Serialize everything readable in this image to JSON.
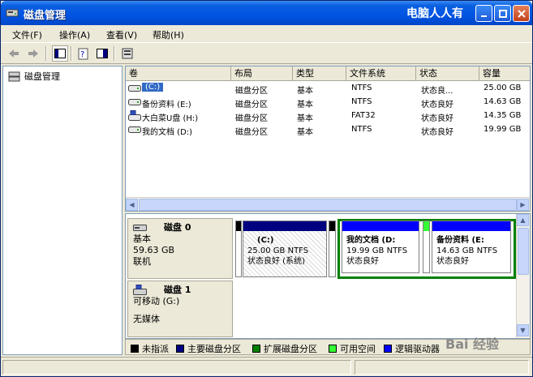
{
  "window": {
    "title": "磁盘管理",
    "watermark": "电脑人人有"
  },
  "menu": [
    {
      "label": "文件(F)"
    },
    {
      "label": "操作(A)"
    },
    {
      "label": "查看(V)"
    },
    {
      "label": "帮助(H)"
    }
  ],
  "tree": {
    "root_label": "磁盘管理"
  },
  "volume_table": {
    "columns": [
      "卷",
      "布局",
      "类型",
      "文件系统",
      "状态",
      "容量"
    ],
    "rows": [
      {
        "volume": "(C:)",
        "layout": "磁盘分区",
        "type": "基本",
        "fs": "NTFS",
        "status": "状态良...",
        "capacity": "25.00 GB",
        "icon": "drive-icon"
      },
      {
        "volume": "备份资料 (E:)",
        "layout": "磁盘分区",
        "type": "基本",
        "fs": "NTFS",
        "status": "状态良好",
        "capacity": "14.63 GB",
        "icon": "drive-icon"
      },
      {
        "volume": "大白菜U盘 (H:)",
        "layout": "磁盘分区",
        "type": "基本",
        "fs": "FAT32",
        "status": "状态良好",
        "capacity": "14.35 GB",
        "icon": "usb-drive-icon"
      },
      {
        "volume": "我的文档 (D:)",
        "layout": "磁盘分区",
        "type": "基本",
        "fs": "NTFS",
        "status": "状态良好",
        "capacity": "19.99 GB",
        "icon": "drive-icon"
      }
    ]
  },
  "disks": [
    {
      "name": "磁盘 0",
      "type": "基本",
      "size": "59.63 GB",
      "state": "联机",
      "partitions": [
        {
          "label": "(C:)",
          "line1": "25.00 GB NTFS",
          "line2": "状态良好 (系统)"
        },
        {
          "label": "我的文档 (D:",
          "line1": "19.99 GB NTFS",
          "line2": "状态良好"
        },
        {
          "label": "备份资料  (E:",
          "line1": "14.63 GB NTFS",
          "line2": "状态良好"
        }
      ]
    },
    {
      "name": "磁盘 1",
      "type": "可移动 (G:)",
      "media": "无媒体"
    }
  ],
  "legend": [
    {
      "label": "未指派",
      "color": "#000000"
    },
    {
      "label": "主要磁盘分区",
      "color": "#000080"
    },
    {
      "label": "扩展磁盘分区",
      "color": "#008000"
    },
    {
      "label": "可用空间",
      "color": "#33FF33"
    },
    {
      "label": "逻辑驱动器",
      "color": "#0000FF"
    }
  ],
  "bottom_watermark": "Bai 经验"
}
